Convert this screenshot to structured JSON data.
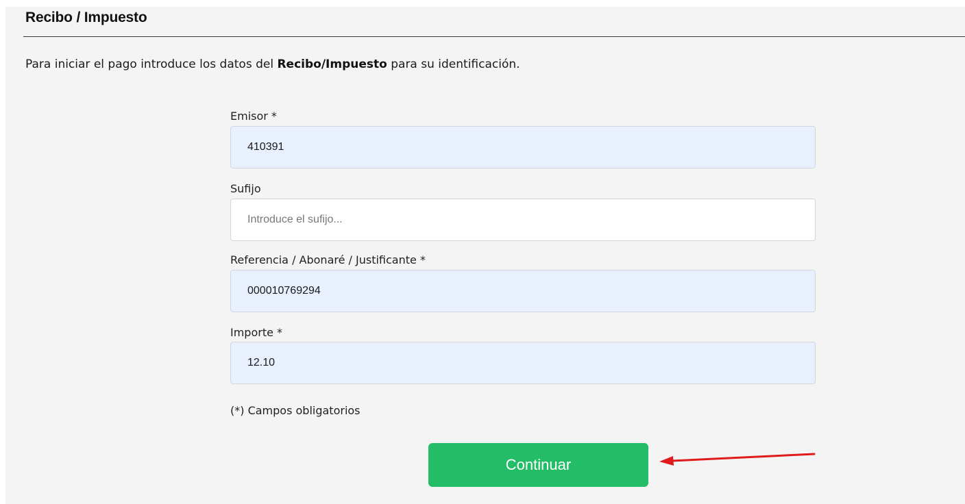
{
  "section": {
    "title": "Recibo / Impuesto"
  },
  "intro": {
    "before": "Para iniciar el pago introduce los datos del ",
    "bold": "Recibo/Impuesto",
    "after": " para su identificación."
  },
  "form": {
    "emisor": {
      "label": "Emisor *",
      "value": "410391"
    },
    "sufijo": {
      "label": "Sufijo",
      "value": "",
      "placeholder": "Introduce el sufijo..."
    },
    "referencia": {
      "label": "Referencia / Abonaré / Justificante *",
      "value": "000010769294"
    },
    "importe": {
      "label": "Importe *",
      "value": "12.10"
    },
    "required_note": "(*) Campos obligatorios",
    "continue_label": "Continuar"
  },
  "colors": {
    "panel_background": "#f4f4f4",
    "autofill_background": "#e8f0fe",
    "button_green": "#22bd66",
    "arrow_red": "#e01b1b"
  }
}
